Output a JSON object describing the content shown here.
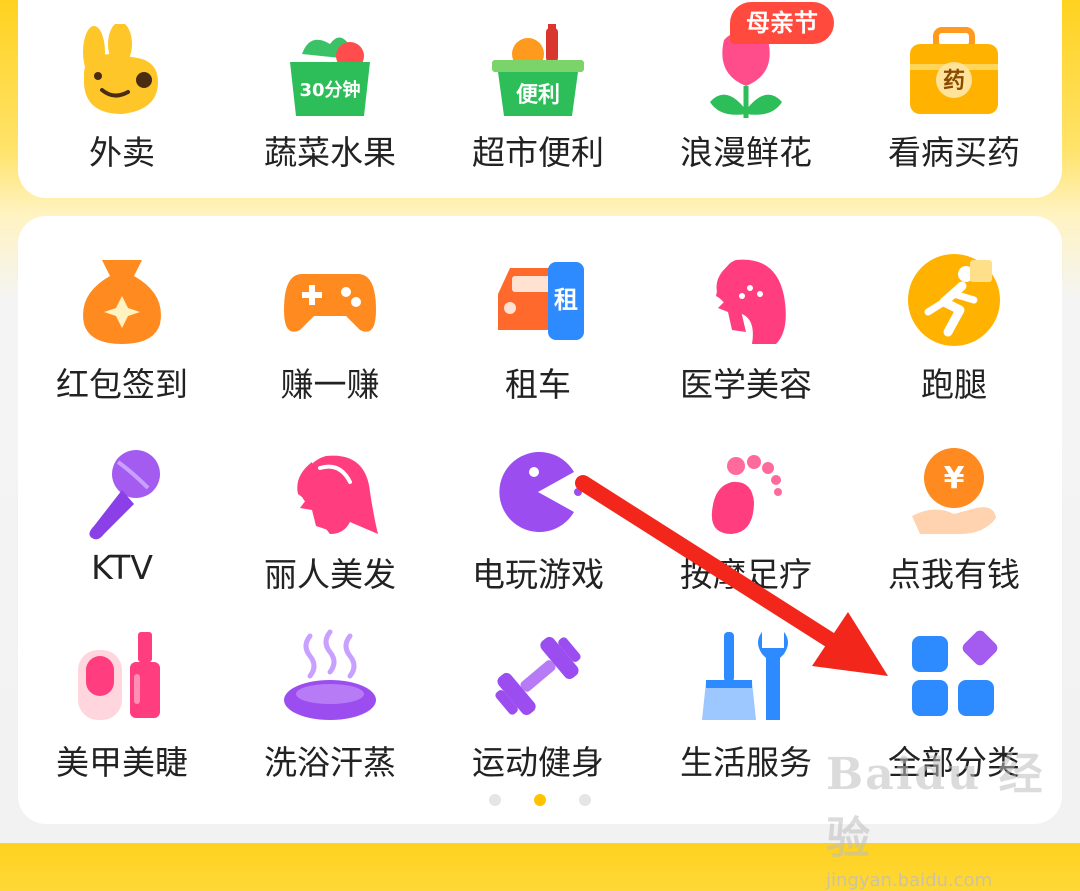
{
  "top_row": [
    {
      "label": "外卖",
      "icon": "rabbit-mascot-icon",
      "color": "#FFC62A"
    },
    {
      "label": "蔬菜水果",
      "icon": "vegetable-basket-icon",
      "color": "#2DBE5A",
      "icon_text": "30分钟"
    },
    {
      "label": "超市便利",
      "icon": "grocery-basket-icon",
      "color": "#2DBE5A",
      "icon_text": "便利"
    },
    {
      "label": "浪漫鲜花",
      "icon": "tulip-flower-icon",
      "color": "#FF4D8B"
    },
    {
      "label": "看病买药",
      "icon": "medicine-box-icon",
      "color": "#FFB300",
      "icon_text": "药"
    }
  ],
  "flower_badge": "母亲节",
  "grid": [
    [
      {
        "label": "红包签到",
        "icon": "money-bag-icon"
      },
      {
        "label": "赚一赚",
        "icon": "gamepad-icon"
      },
      {
        "label": "租车",
        "icon": "car-rental-icon",
        "icon_text": "租"
      },
      {
        "label": "医学美容",
        "icon": "beauty-face-icon"
      },
      {
        "label": "跑腿",
        "icon": "running-man-icon"
      }
    ],
    [
      {
        "label": "KTV",
        "icon": "microphone-icon"
      },
      {
        "label": "丽人美发",
        "icon": "hair-salon-icon"
      },
      {
        "label": "电玩游戏",
        "icon": "pacman-icon"
      },
      {
        "label": "按摩足疗",
        "icon": "footprint-icon"
      },
      {
        "label": "点我有钱",
        "icon": "yen-coin-hand-icon",
        "icon_text": "¥"
      }
    ],
    [
      {
        "label": "美甲美睫",
        "icon": "nail-polish-icon"
      },
      {
        "label": "洗浴汗蒸",
        "icon": "sauna-steam-icon"
      },
      {
        "label": "运动健身",
        "icon": "dumbbell-icon"
      },
      {
        "label": "生活服务",
        "icon": "broom-wrench-icon"
      },
      {
        "label": "全部分类",
        "icon": "all-categories-icon"
      }
    ]
  ],
  "pagination": {
    "pages": 3,
    "active": 1
  },
  "watermark": {
    "logo": "Baidu 经验",
    "url": "jingyan.baidu.com"
  },
  "colors": {
    "accent": "#FFC300",
    "arrow": "#F2261B"
  }
}
